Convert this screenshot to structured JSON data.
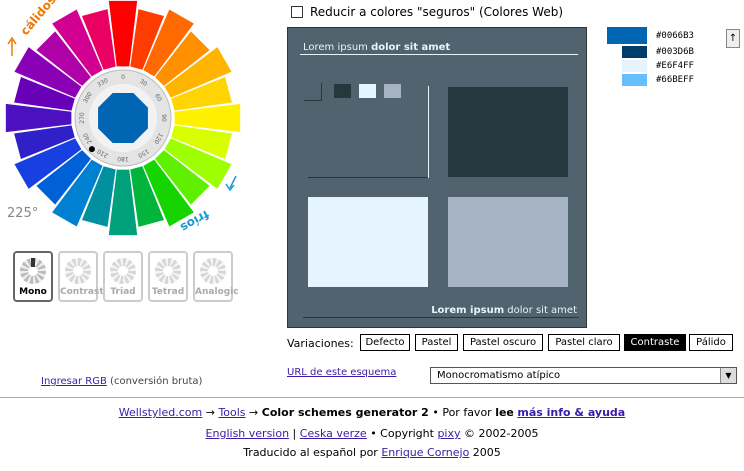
{
  "wheel": {
    "warm_label": "cálidos",
    "cold_label": "fríos",
    "angle_label": "225°",
    "dial_ticks": [
      "0",
      "30",
      "60",
      "90",
      "120",
      "150",
      "180",
      "210",
      "240",
      "270",
      "300",
      "330"
    ],
    "selected_hue_deg": 225,
    "center_color": "#0066B3",
    "hue_colors": [
      "#ff0000",
      "#ff3c00",
      "#ff6a00",
      "#ff9000",
      "#ffb400",
      "#ffd400",
      "#fff000",
      "#d8ff00",
      "#9eff00",
      "#5ef000",
      "#16d400",
      "#00b43c",
      "#00a07a",
      "#0090a0",
      "#0080d0",
      "#0060d8",
      "#1840e0",
      "#3020c8",
      "#4c10c0",
      "#6800b8",
      "#8a00b4",
      "#b000a8",
      "#d20090",
      "#ea0060"
    ]
  },
  "schemes": [
    {
      "label": "Mono",
      "active": true
    },
    {
      "label": "Contrast",
      "active": false
    },
    {
      "label": "Triad",
      "active": false
    },
    {
      "label": "Tetrad",
      "active": false
    },
    {
      "label": "Analogic",
      "active": false
    }
  ],
  "websafe": {
    "label": "Reducir a colores \"seguros\" (Colores Web)",
    "checked": false
  },
  "preview": {
    "title_plain": "Lorem ipsum ",
    "title_bold": "dolor sit amet",
    "footer_bold": "Lorem ipsum",
    "footer_plain": " dolor sit amet",
    "bg": "#51636E",
    "dark": "#27373E",
    "light": "#E6F4FF",
    "pale": "#A6B3C4"
  },
  "swatches": [
    {
      "hex": "#0066B3",
      "label": "#0066B3"
    },
    {
      "hex": "#003D6B",
      "label": "#003D6B"
    },
    {
      "hex": "#E6F4FF",
      "label": "#E6F4FF"
    },
    {
      "hex": "#66BEFF",
      "label": "#66BEFF"
    }
  ],
  "variations": {
    "label": "Variaciones:",
    "options": [
      {
        "label": "Defecto",
        "active": false
      },
      {
        "label": "Pastel",
        "active": false
      },
      {
        "label": "Pastel oscuro",
        "active": false
      },
      {
        "label": "Pastel claro",
        "active": false
      },
      {
        "label": "Contraste",
        "active": true
      },
      {
        "label": "Pálido",
        "active": false
      }
    ]
  },
  "rgb_input": {
    "link": "Ingresar RGB",
    "note": " (conversión bruta)"
  },
  "url_link": "URL de este esquema",
  "scheme_select": {
    "value": "Monocromatismo atípico"
  },
  "scroll_up": "↑",
  "footer": {
    "line1": {
      "site": "Wellstyled.com",
      "arrow1": " → ",
      "tools": "Tools",
      "arrow2": " → ",
      "app": "Color schemes generator 2",
      "sep": " • Por favor ",
      "lee": "lee",
      "space": " ",
      "more": "más info & ayuda"
    },
    "line2": {
      "english": "English version",
      "bar": " | ",
      "czech": "Ceska verze",
      "copy1": " • Copyright ",
      "author": "pixy",
      "copy2": " © 2002-2005"
    },
    "line3": {
      "text": "Traducido al español por ",
      "translator": "Enrique Cornejo",
      "year": " 2005"
    }
  }
}
